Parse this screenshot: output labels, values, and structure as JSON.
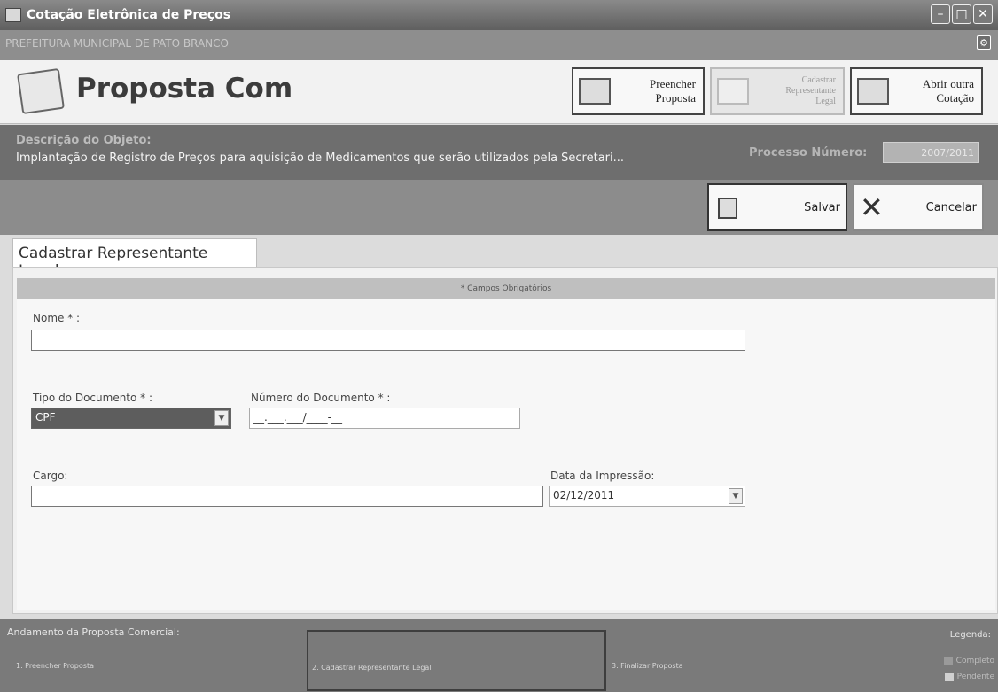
{
  "window": {
    "title": "Cotação Eletrônica de Preços",
    "organization": "PREFEITURA MUNICIPAL DE PATO BRANCO"
  },
  "header": {
    "page_title": "Proposta Com",
    "buttons": {
      "preencher": "Preencher\nProposta",
      "cadastrar": "Cadastrar\nRepresentante\nLegal",
      "abrir": "Abrir outra\nCotação"
    }
  },
  "object": {
    "label": "Descrição do Objeto:",
    "text": "Implantação de Registro de Preços para aquisição de Medicamentos que serão utilizados pela Secretari...",
    "process_label": "Processo Número:",
    "process_value": "2007/2011"
  },
  "actions": {
    "save": "Salvar",
    "cancel": "Cancelar"
  },
  "tab": {
    "label": "Cadastrar Representante Legal"
  },
  "form": {
    "required_note": "* Campos Obrigatórios",
    "nome_label": "Nome * :",
    "nome_value": "",
    "tipo_label": "Tipo do Documento * :",
    "tipo_value": "CPF",
    "numero_label": "Número do Documento * :",
    "numero_value": "__.___.___/____-__",
    "cargo_label": "Cargo:",
    "cargo_value": "",
    "data_label": "Data da Impressão:",
    "data_value": "02/12/2011"
  },
  "progress": {
    "title": "Andamento da Proposta Comercial:",
    "steps": [
      "1. Preencher Proposta",
      "2. Cadastrar Representante Legal",
      "3. Finalizar Proposta"
    ],
    "legend_title": "Legenda:",
    "legend": [
      "Completo",
      "Pendente"
    ]
  }
}
